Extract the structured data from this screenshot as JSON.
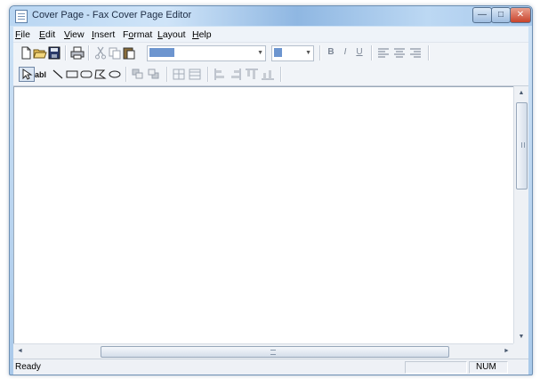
{
  "window": {
    "title": "Cover Page - Fax Cover Page Editor",
    "controls": {
      "minimize": "—",
      "maximize": "□",
      "close": "✕"
    }
  },
  "menu": {
    "items": [
      {
        "key": "F",
        "rest": "ile"
      },
      {
        "key": "E",
        "rest": "dit"
      },
      {
        "key": "V",
        "rest": "iew"
      },
      {
        "key": "I",
        "rest": "nsert"
      },
      {
        "key": "",
        "pre": "F",
        "key2": "o",
        "rest": "rmat"
      },
      {
        "key": "L",
        "rest": "ayout"
      },
      {
        "key": "H",
        "rest": "elp"
      }
    ]
  },
  "toolbar1": {
    "icons": [
      "new-icon",
      "open-icon",
      "save-icon",
      "print-icon",
      "cut-icon",
      "copy-icon",
      "paste-icon"
    ],
    "format_labels": {
      "bold": "B",
      "italic": "I",
      "underline": "U"
    },
    "align_icons": [
      "align-left-icon",
      "align-center-icon",
      "align-right-icon"
    ]
  },
  "toolbar2": {
    "icons": [
      "select-icon",
      "text-icon",
      "line-icon",
      "rectangle-icon",
      "rounded-rectangle-icon",
      "polygon-icon",
      "ellipse-icon",
      "bring-to-front-icon",
      "send-to-back-icon",
      "space-across-icon",
      "space-down-icon",
      "align-left-objects-icon",
      "align-right-objects-icon",
      "align-top-icon",
      "align-bottom-icon"
    ]
  },
  "scrollbars": {
    "up": "▲",
    "down": "▼",
    "left": "◄",
    "right": "►"
  },
  "status": {
    "text": "Ready",
    "num": "NUM"
  },
  "colors": {
    "selection": "#6d95cf",
    "titlebar": "#b9d6f2",
    "close": "#c8432b"
  }
}
